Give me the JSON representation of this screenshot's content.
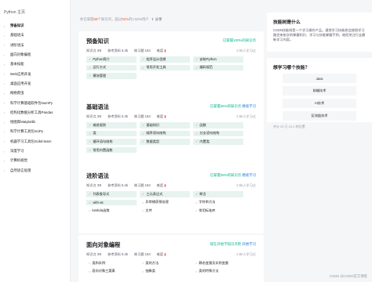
{
  "sidebar": {
    "title": "Python 主页",
    "items": [
      {
        "label": "预备知识"
      },
      {
        "label": "基础语法"
      },
      {
        "label": "进阶语法"
      },
      {
        "label": "面向对象编程"
      },
      {
        "label": "基本技能"
      },
      {
        "label": "Web应用开发"
      },
      {
        "label": "桌面应用开发"
      },
      {
        "label": "网络爬虫"
      },
      {
        "label": "科学计算基础软件包NumPy"
      },
      {
        "label": "结构化数据分析工具Pandas"
      },
      {
        "label": "绘图库Matplotlib"
      },
      {
        "label": "科学计算工具包SciPy"
      },
      {
        "label": "机器学习工具包Scikit-learn"
      },
      {
        "label": "深度学习"
      },
      {
        "label": "计算机视觉"
      },
      {
        "label": "自然语言处理"
      }
    ]
  },
  "topline": {
    "prefix": "你已掌握",
    "count": "58",
    "middle": "个知识点，超过",
    "percent": "92%",
    "suffix": "的CSDN用户",
    "share": "分享"
  },
  "cards": [
    {
      "title": "预备知识",
      "status": "已掌握100%的知识点",
      "status_link": "",
      "stats": {
        "points": "知识点 3⁄6",
        "refs": "参考资料 5.3k",
        "exercises": "练习题 163",
        "difficulty": "难度",
        "learners": "2.5k人学习过"
      },
      "chips": [
        {
          "label": "Python简介",
          "done": true
        },
        {
          "label": "程序设计思想",
          "done": true
        },
        {
          "label": "安装Python",
          "done": true
        },
        {
          "label": "运行方式",
          "done": true
        },
        {
          "label": "常用开发工具",
          "done": true
        },
        {
          "label": "编码规范",
          "done": true
        },
        {
          "label": "模块管理",
          "done": true
        }
      ]
    },
    {
      "title": "基础语法",
      "status": "已掌握46%的知识点",
      "status_link": "继续学习",
      "stats": {
        "points": "知识点 3⁄6",
        "refs": "参考资料 5.3k",
        "exercises": "练习题 163",
        "difficulty": "难度",
        "learners": "2.5k人学习过"
      },
      "chips": [
        {
          "label": "缩进规则",
          "done": true
        },
        {
          "label": "基础知识",
          "done": true
        },
        {
          "label": "函数",
          "done": true
        },
        {
          "label": "类",
          "done": true
        },
        {
          "label": "顺序语句结构",
          "done": true
        },
        {
          "label": "分支语句结构",
          "done": true
        },
        {
          "label": "循环语句结构",
          "done": true
        },
        {
          "label": "数据类型",
          "done": true
        },
        {
          "label": "内置类",
          "done": true
        },
        {
          "label": "常用内置函数",
          "done": true
        }
      ]
    },
    {
      "title": "进阶语法",
      "status": "已掌握28%的知识点",
      "status_link": "继续学习",
      "stats": {
        "points": "知识点 3⁄6",
        "refs": "参考资料 5.3k",
        "exercises": "练习题 163",
        "difficulty": "难度",
        "learners": "2.5k人学习过"
      },
      "chips": [
        {
          "label": "列表推导式",
          "done": true
        },
        {
          "label": "三元表达式",
          "done": true
        },
        {
          "label": "断言",
          "done": true
        },
        {
          "label": "with-as",
          "done": true
        },
        {
          "label": "异常捕获预处理",
          "done": false
        },
        {
          "label": "字符串方法",
          "done": false
        },
        {
          "label": "lambda函数",
          "done": false
        },
        {
          "label": "文件",
          "done": false
        },
        {
          "label": "常用标准库",
          "done": false
        }
      ]
    },
    {
      "title": "面向对象编程",
      "status": "现在开始学知识点吧",
      "status_link": "开始学习",
      "stats": {
        "points": "知识点 3⁄6",
        "refs": "参考资料 5.3k",
        "exercises": "练习题 163",
        "difficulty": "难度",
        "learners": "2.5k人学习过"
      },
      "chips": [
        {
          "label": "类和实例",
          "done": false
        },
        {
          "label": "类的方法",
          "done": false
        },
        {
          "label": "静态变量及实例变量",
          "done": false
        },
        {
          "label": "面向对象三要素",
          "done": false
        },
        {
          "label": "抽象类",
          "done": false
        },
        {
          "label": "类的特殊方法",
          "done": false
        }
      ]
    }
  ],
  "right": {
    "intro_title": "技能树是什么",
    "intro_desc": "CSDN技能树是一个学习操作产品。通常学习技能树会按照学习路径来依次的掌握知识、学习与技能掌握不到，继而关注行业最新学习内容。",
    "survey_title": "想学习哪个技能？",
    "options": [
      {
        "label": "Java"
      },
      {
        "label": "前端技术"
      },
      {
        "label": "AI技术"
      },
      {
        "label": "区块链技术"
      }
    ],
    "survey_foot": "共计 25 万 23.2 的位置"
  },
  "watermark": "CSDN @CSDN官方博客"
}
